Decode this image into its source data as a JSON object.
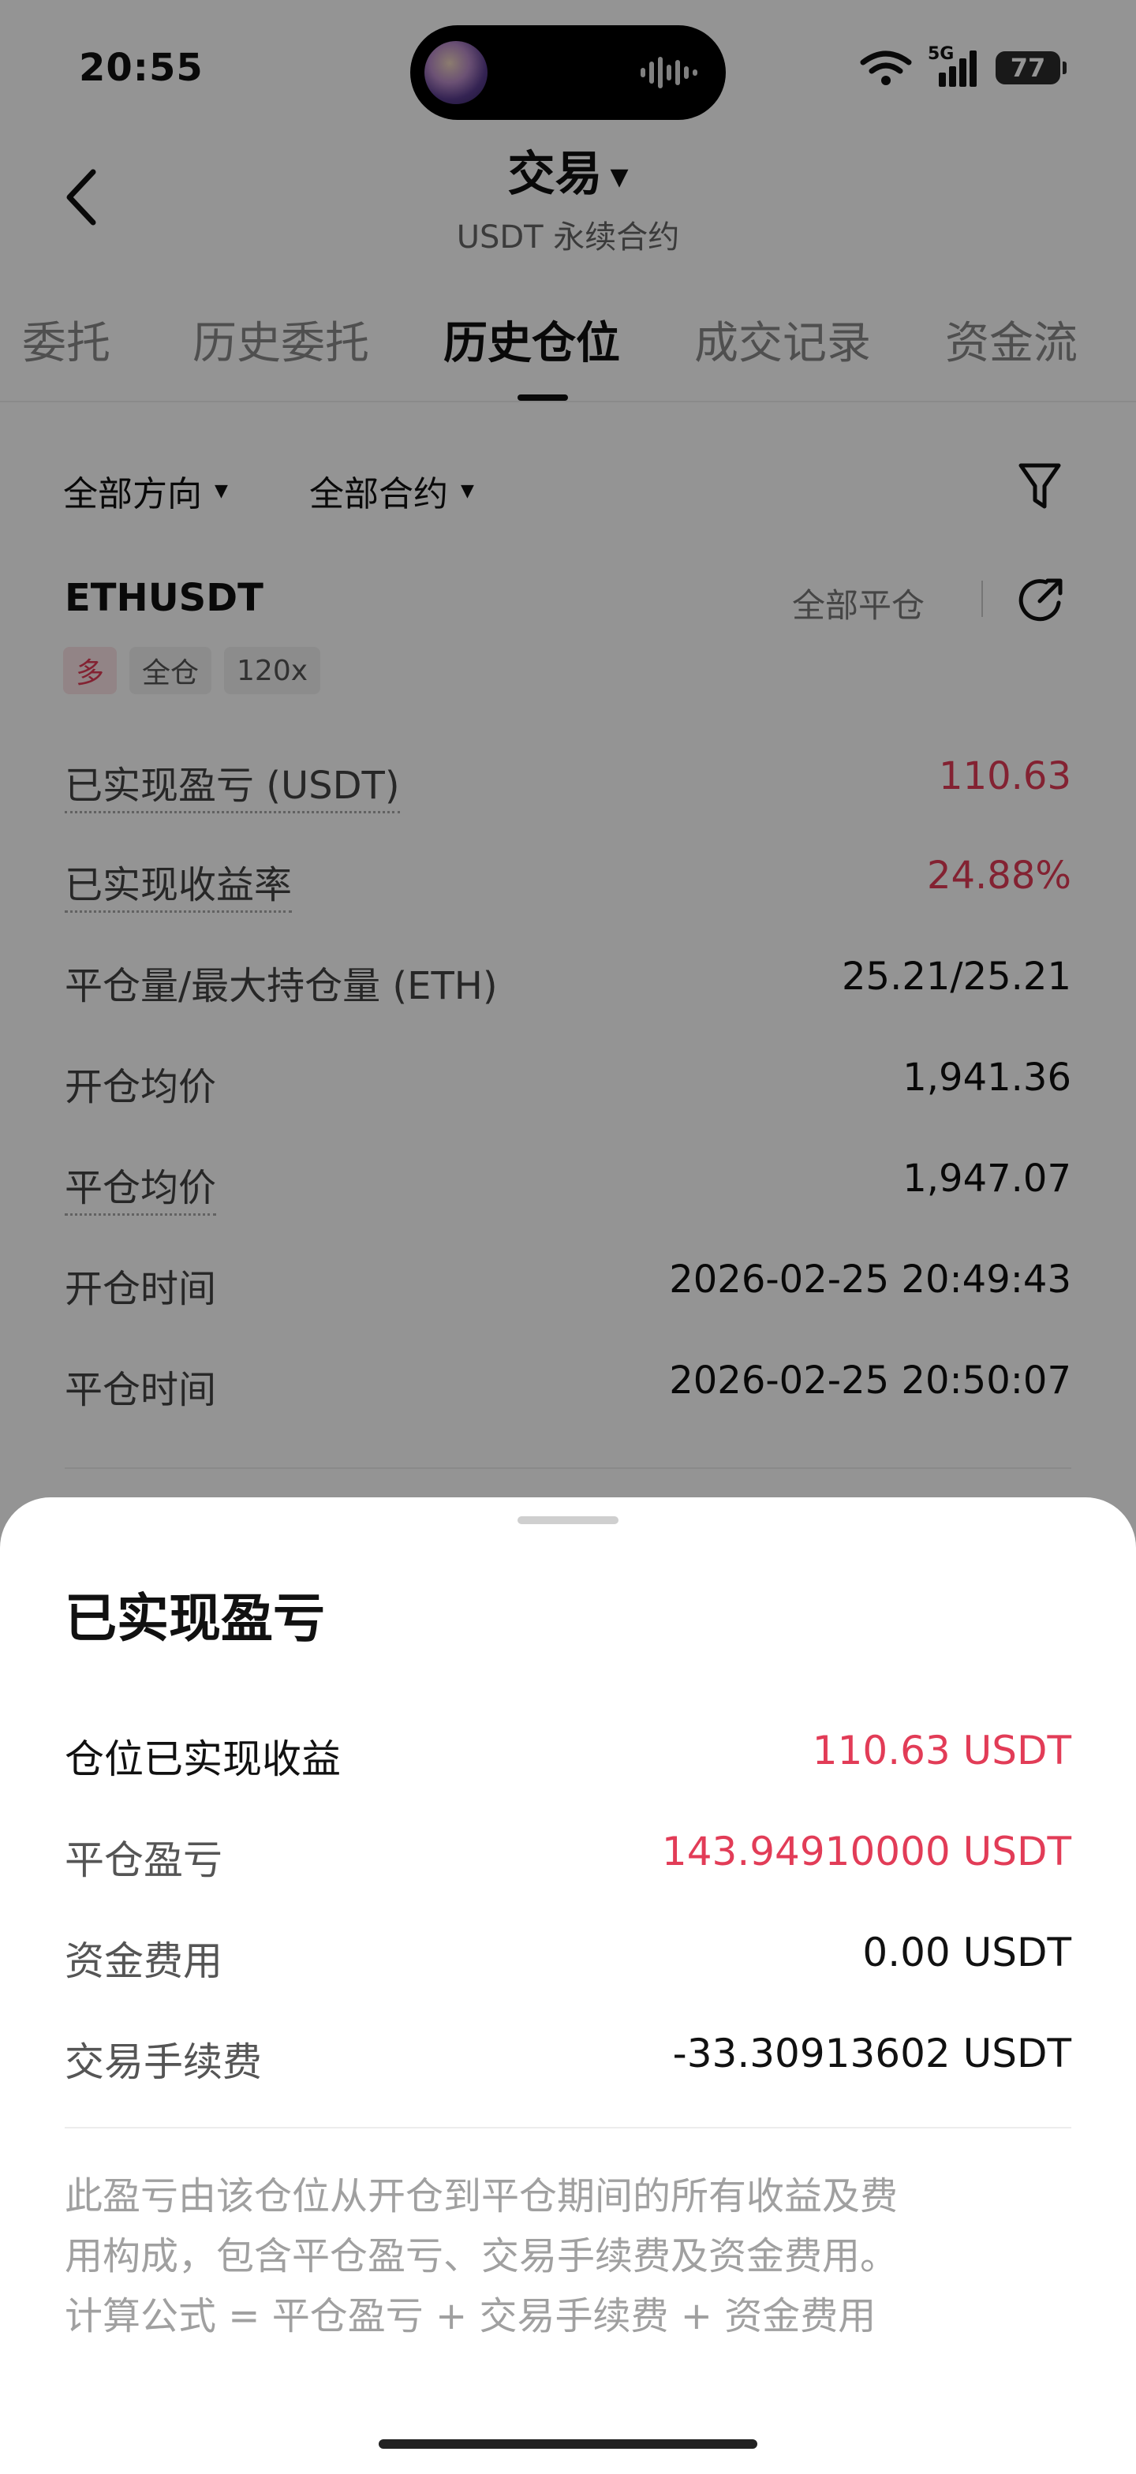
{
  "status_bar": {
    "time": "20:55",
    "network": "5G",
    "battery": "77"
  },
  "header": {
    "title": "交易",
    "subtitle": "USDT 永续合约"
  },
  "tabs": [
    {
      "label": "委托"
    },
    {
      "label": "历史委托"
    },
    {
      "label": "历史仓位",
      "active": true
    },
    {
      "label": "成交记录"
    },
    {
      "label": "资金流"
    }
  ],
  "filters": {
    "direction": "全部方向",
    "contract": "全部合约"
  },
  "position": {
    "symbol": "ETHUSDT",
    "close_all": "全部平仓",
    "tags": {
      "side": "多",
      "margin_mode": "全仓",
      "leverage": "120x"
    },
    "rows": [
      {
        "label": "已实现盈亏 (USDT)",
        "value": "110.63",
        "highlight": true,
        "dotted": true
      },
      {
        "label": "已实现收益率",
        "value": "24.88%",
        "highlight": true,
        "dotted": true
      },
      {
        "label": "平仓量/最大持仓量 (ETH)",
        "value": "25.21/25.21"
      },
      {
        "label": "开仓均价",
        "value": "1,941.36"
      },
      {
        "label": "平仓均价",
        "value": "1,947.07",
        "dotted": true
      },
      {
        "label": "开仓时间",
        "value": "2026-02-25 20:49:43"
      },
      {
        "label": "平仓时间",
        "value": "2026-02-25 20:50:07"
      }
    ]
  },
  "sheet": {
    "title": "已实现盈亏",
    "rows": [
      {
        "label": "仓位已实现收益",
        "value": "110.63 USDT"
      },
      {
        "label": "平仓盈亏",
        "value": "143.94910000 USDT"
      },
      {
        "label": "资金费用",
        "value": "0.00 USDT"
      },
      {
        "label": "交易手续费",
        "value": "-33.30913602 USDT"
      }
    ],
    "note_lines": [
      "此盈亏由该仓位从开仓到平仓期间的所有收益及费",
      "用构成，包含平仓盈亏、交易手续费及资金费用。",
      "计算公式 = 平仓盈亏 + 交易手续费 + 资金费用"
    ]
  },
  "colors": {
    "profit_red": "#e23c57",
    "overlay": "rgba(0,0,0,0.42)"
  }
}
